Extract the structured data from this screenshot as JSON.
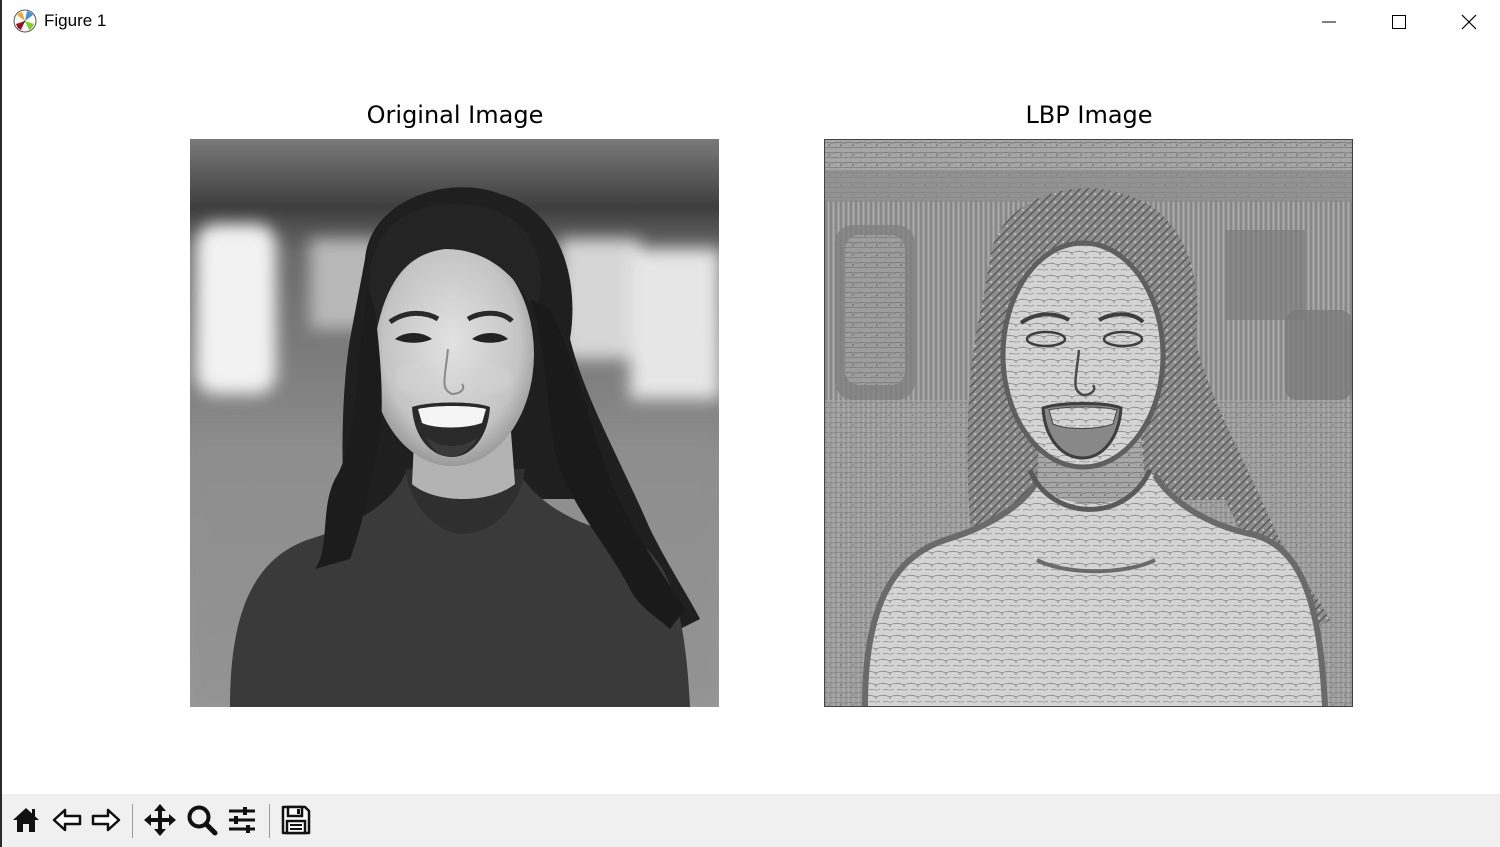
{
  "window": {
    "title": "Figure 1",
    "controls": [
      "minimize-icon",
      "maximize-icon",
      "close-icon"
    ]
  },
  "figure": {
    "axes": [
      {
        "title": "Original Image",
        "content": "grayscale photograph of a smiling woman with long dark wavy hair"
      },
      {
        "title": "LBP Image",
        "content": "local binary pattern texture image of the same photograph"
      }
    ]
  },
  "toolbar": {
    "buttons": [
      "home-icon",
      "back-icon",
      "forward-icon",
      "pan-icon",
      "zoom-icon",
      "configure-subplots-icon",
      "save-icon"
    ]
  }
}
